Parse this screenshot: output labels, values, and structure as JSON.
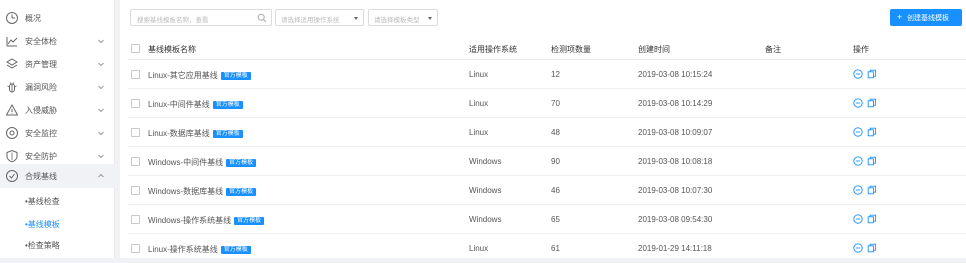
{
  "sidebar": {
    "items": [
      {
        "label": "概况",
        "icon": "gauge-icon",
        "has_chevron": false
      },
      {
        "label": "安全体检",
        "icon": "line-chart-icon",
        "has_chevron": true
      },
      {
        "label": "资产管理",
        "icon": "layers-icon",
        "has_chevron": true
      },
      {
        "label": "漏洞风险",
        "icon": "bug-icon",
        "has_chevron": true
      },
      {
        "label": "入侵威胁",
        "icon": "warning-icon",
        "has_chevron": true
      },
      {
        "label": "安全监控",
        "icon": "target-icon",
        "has_chevron": true
      },
      {
        "label": "安全防护",
        "icon": "shield-icon",
        "has_chevron": true
      },
      {
        "label": "合规基线",
        "icon": "compliance-icon",
        "has_chevron": true,
        "expanded": true
      }
    ],
    "sub_items": [
      {
        "label": "•基线检查",
        "selected": false
      },
      {
        "label": "•基线模板",
        "selected": true
      },
      {
        "label": "•检查策略",
        "selected": false
      }
    ]
  },
  "toolbar": {
    "search_placeholder": "搜索基线模板名称，查看",
    "os_select_placeholder": "请选择适用操作系统",
    "type_select_placeholder": "请选择模板类型",
    "create_label": "创建基线模板"
  },
  "table": {
    "headers": [
      "基线模板名称",
      "适用操作系统",
      "检测项数量",
      "创建时间",
      "备注",
      "操作"
    ],
    "tag_label": "官方模板",
    "rows": [
      {
        "name": "Linux-其它应用基线",
        "os": "Linux",
        "count": "12",
        "created": "2019-03-08 10:15:24",
        "note": ""
      },
      {
        "name": "Linux-中间件基线",
        "os": "Linux",
        "count": "70",
        "created": "2019-03-08 10:14:29",
        "note": ""
      },
      {
        "name": "Linux-数据库基线",
        "os": "Linux",
        "count": "48",
        "created": "2019-03-08 10:09:07",
        "note": ""
      },
      {
        "name": "Windows-中间件基线",
        "os": "Windows",
        "count": "90",
        "created": "2019-03-08 10:08:18",
        "note": ""
      },
      {
        "name": "Windows-数据库基线",
        "os": "Windows",
        "count": "46",
        "created": "2019-03-08 10:07:30",
        "note": ""
      },
      {
        "name": "Windows-操作系统基线",
        "os": "Windows",
        "count": "65",
        "created": "2019-03-08 09:54:30",
        "note": ""
      },
      {
        "name": "Linux-操作系统基线",
        "os": "Linux",
        "count": "61",
        "created": "2019-01-29 14:11:18",
        "note": ""
      }
    ]
  },
  "colors": {
    "accent": "#1890ff",
    "sidebar_bg": "#ffffff",
    "page_bg": "#f0f2f5"
  }
}
